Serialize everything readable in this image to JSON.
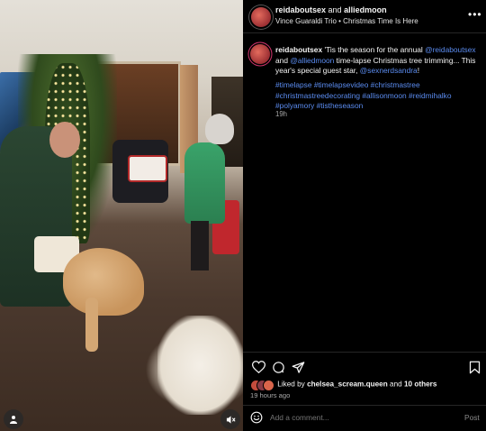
{
  "header": {
    "account_primary": "reidaboutsex",
    "and_text": "and",
    "account_secondary": "alliedmoon",
    "song_artist": "Vince Guaraldi Trio",
    "separator": "•",
    "song_title": "Christmas Time Is Here",
    "more_icon": "more-horizontal-icon"
  },
  "caption": {
    "author": "reidaboutsex",
    "text_part1": "'Tis the season for the annual",
    "mention1": "@reidaboutsex",
    "text_part2": "and",
    "mention2": "@alliedmoon",
    "text_part3": "time-lapse Christmas tree trimming... This year's special guest star,",
    "mention3": "@sexnerdsandra",
    "text_part4": "!",
    "hashtags_line1": "#timelapse #timelapsevideo #christmastree",
    "hashtags_line2": "#christmastreedecorating #allisonmoon #reidmihalko",
    "hashtags_line3": "#polyamory #tistheseason",
    "time": "19h"
  },
  "actions": {
    "like_icon": "heart-icon",
    "comment_icon": "comment-icon",
    "share_icon": "share-icon",
    "save_icon": "bookmark-icon"
  },
  "likes": {
    "prefix": "Liked by",
    "user": "chelsea_scream.queen",
    "suffix": "and",
    "others": "10 others"
  },
  "posted": "19 hours ago",
  "comment": {
    "placeholder": "Add a comment...",
    "post_label": "Post",
    "emoji_icon": "emoji-icon"
  },
  "media": {
    "tag_icon": "person-tag-icon",
    "mute_icon": "mute-icon"
  }
}
